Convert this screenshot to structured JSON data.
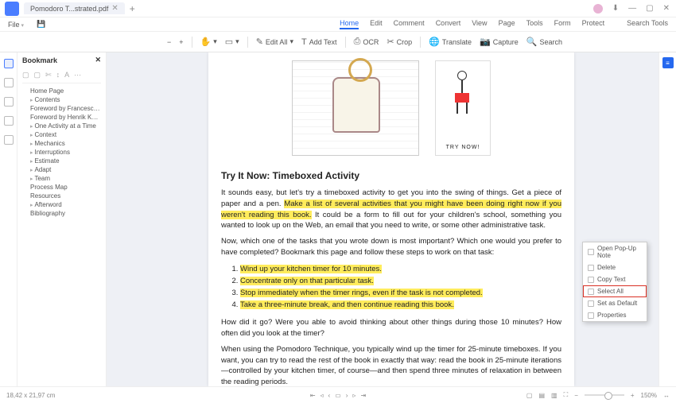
{
  "titlebar": {
    "tab_name": "Pomodoro T...strated.pdf",
    "tab_add": "+"
  },
  "win": {
    "min": "—",
    "max": "▢",
    "close": "✕",
    "download": "⬇"
  },
  "menubar": {
    "file": "File",
    "tabs": [
      "Home",
      "Edit",
      "Comment",
      "Convert",
      "View",
      "Page",
      "Tools",
      "Form",
      "Protect"
    ],
    "active_tab": "Home",
    "search_tools": "Search Tools"
  },
  "toolbar": {
    "zoom_out": "−",
    "zoom_in": "+",
    "hand": "✋",
    "select": "▭",
    "edit_all": "Edit All",
    "add_text": "Add Text",
    "ocr": "OCR",
    "crop": "Crop",
    "translate": "Translate",
    "capture": "Capture",
    "search": "Search"
  },
  "bookmark": {
    "title": "Bookmark",
    "close": "✕",
    "items": [
      {
        "label": "Home Page",
        "leaf": true
      },
      {
        "label": "Contents",
        "leaf": false
      },
      {
        "label": "Foreword by Francesco Cirillo",
        "leaf": true
      },
      {
        "label": "Foreword by Henrik Kniberg",
        "leaf": true
      },
      {
        "label": "One Activity at a Time",
        "leaf": false
      },
      {
        "label": "Context",
        "leaf": false
      },
      {
        "label": "Mechanics",
        "leaf": false
      },
      {
        "label": "Interruptions",
        "leaf": false
      },
      {
        "label": "Estimate",
        "leaf": false
      },
      {
        "label": "Adapt",
        "leaf": false
      },
      {
        "label": "Team",
        "leaf": false
      },
      {
        "label": "Process Map",
        "leaf": true
      },
      {
        "label": "Resources",
        "leaf": true
      },
      {
        "label": "Afterword",
        "leaf": false
      },
      {
        "label": "Bibliography",
        "leaf": true
      }
    ]
  },
  "right_badge": "≡",
  "doc": {
    "try_now_caption": "TRY NOW!",
    "heading": "Try It Now: Timeboxed Activity",
    "p1a": "It sounds easy, but let's try a timeboxed activity to get you into the swing of things. Get a piece of paper and a pen. ",
    "p1_hl": "Make a list of several activities that you might have been doing right now if you weren't reading this book.",
    "p1b": " It could be a form to fill out for your children's school, something you wanted to look up on the Web, an email that you need to write, or some other administrative task.",
    "p2": "Now, which one of the tasks that you wrote down is most important? Which one would you prefer to have completed? Bookmark this page and follow these steps to work on that task:",
    "li1": "Wind up your kitchen timer for 10 minutes.",
    "li2": "Concentrate only on that particular task.",
    "li3": "Stop immediately when the timer rings, even if the task is not completed.",
    "li4": "Take a three-minute break, and then continue reading this book.",
    "p3": "How did it go? Were you able to avoid thinking about other things during those 10 minutes? How often did you look at the timer?",
    "p4": "When using the Pomodoro Technique, you typically wind up the timer for 25-minute timeboxes. If you want, you can try to read the rest of the book in exactly that way: read the book in 25-minute iterations—controlled by your kitchen timer, of course—and then spend three minutes of relaxation in between the reading periods."
  },
  "context_menu": {
    "items": [
      "Open Pop-Up Note",
      "Delete",
      "Copy Text",
      "Select All",
      "Set as Default",
      "Properties"
    ],
    "selected_index": 3
  },
  "statusbar": {
    "dims": "18,42 x 21,97 cm",
    "zoom": "150%"
  }
}
